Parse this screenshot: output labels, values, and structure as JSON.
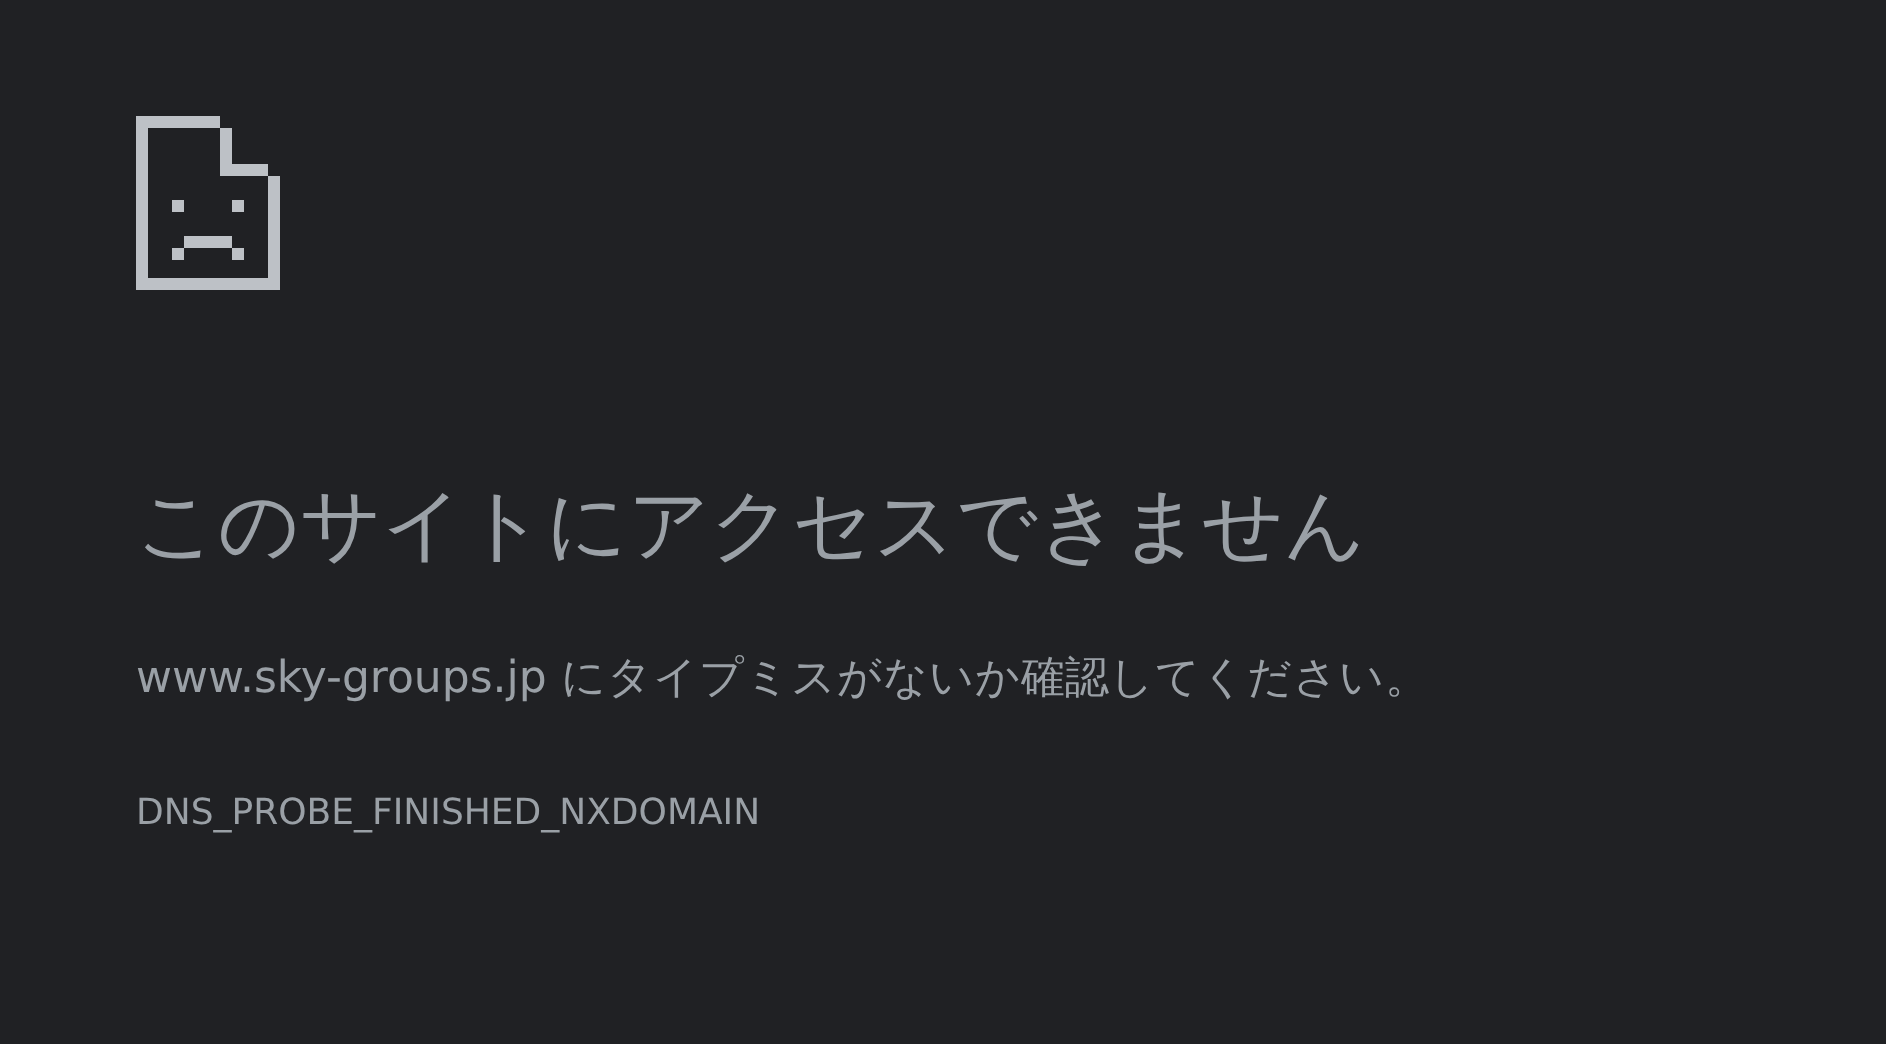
{
  "error_page": {
    "title": "このサイトにアクセスできません",
    "message": "www.sky-groups.jp にタイプミスがないか確認してください。",
    "error_code": "DNS_PROBE_FINISHED_NXDOMAIN"
  }
}
